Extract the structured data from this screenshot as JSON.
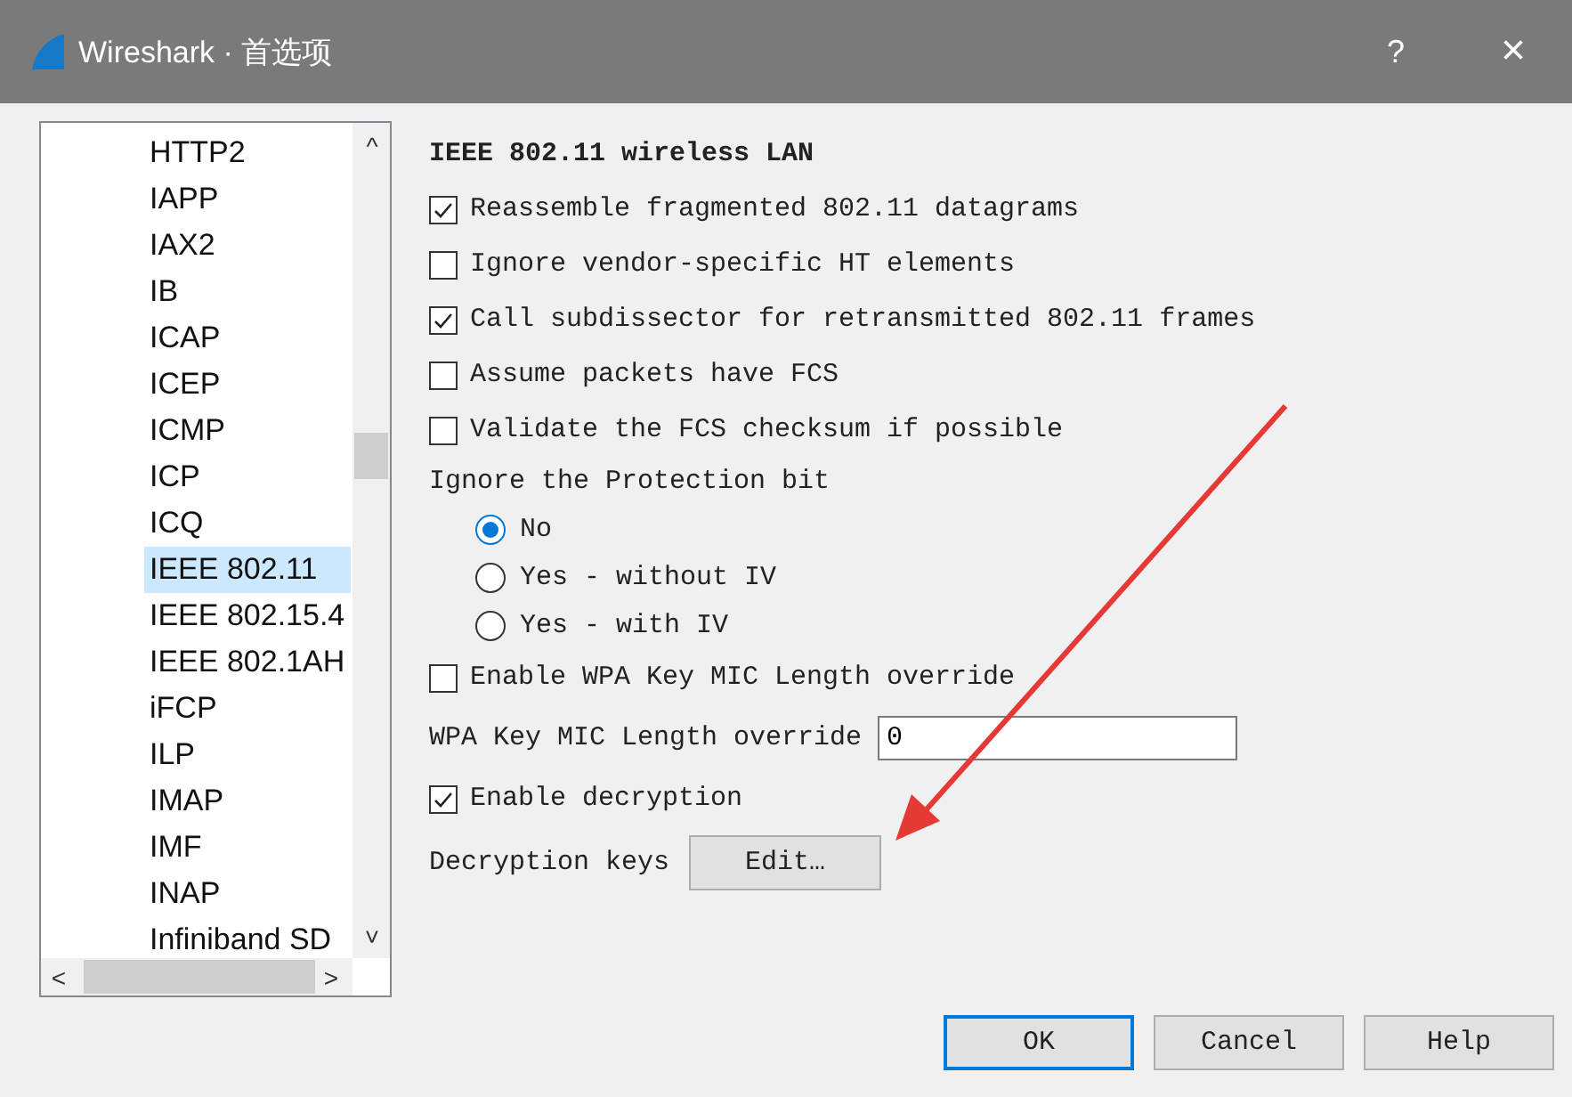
{
  "window": {
    "title": "Wireshark · 首选项",
    "help": "?",
    "close": "×"
  },
  "protocol_list": {
    "scroll_up": "^",
    "scroll_down": "˅",
    "scroll_left": "<",
    "scroll_right": ">",
    "items": [
      {
        "label": "HTTP2",
        "selected": false
      },
      {
        "label": "IAPP",
        "selected": false
      },
      {
        "label": "IAX2",
        "selected": false
      },
      {
        "label": "IB",
        "selected": false
      },
      {
        "label": "ICAP",
        "selected": false
      },
      {
        "label": "ICEP",
        "selected": false
      },
      {
        "label": "ICMP",
        "selected": false
      },
      {
        "label": "ICP",
        "selected": false
      },
      {
        "label": "ICQ",
        "selected": false
      },
      {
        "label": "IEEE 802.11",
        "selected": true
      },
      {
        "label": "IEEE 802.15.4",
        "selected": false
      },
      {
        "label": "IEEE 802.1AH",
        "selected": false
      },
      {
        "label": "iFCP",
        "selected": false
      },
      {
        "label": "ILP",
        "selected": false
      },
      {
        "label": "IMAP",
        "selected": false
      },
      {
        "label": "IMF",
        "selected": false
      },
      {
        "label": "INAP",
        "selected": false
      },
      {
        "label": "Infiniband SD",
        "selected": false
      }
    ]
  },
  "section_title": "IEEE 802.11 wireless LAN",
  "options": [
    {
      "kind": "checkbox",
      "label": "Reassemble fragmented 802.11 datagrams",
      "checked": true
    },
    {
      "kind": "checkbox",
      "label": "Ignore vendor-specific HT elements",
      "checked": false
    },
    {
      "kind": "checkbox",
      "label": "Call subdissector for retransmitted 802.11 frames",
      "checked": true
    },
    {
      "kind": "checkbox",
      "label": "Assume packets have FCS",
      "checked": false
    },
    {
      "kind": "checkbox",
      "label": "Validate the FCS checksum if possible",
      "checked": false
    },
    {
      "kind": "heading",
      "label": "Ignore the Protection bit"
    },
    {
      "kind": "radio",
      "label": "No",
      "selected": true
    },
    {
      "kind": "radio",
      "label": "Yes - without IV",
      "selected": false
    },
    {
      "kind": "radio",
      "label": "Yes - with IV",
      "selected": false
    },
    {
      "kind": "checkbox",
      "label": "Enable WPA Key MIC Length override",
      "checked": false
    },
    {
      "kind": "field",
      "label": "WPA Key MIC Length override",
      "value": "0"
    },
    {
      "kind": "checkbox",
      "label": "Enable decryption",
      "checked": true
    },
    {
      "kind": "button",
      "label": "Decryption keys",
      "button": "Edit…"
    }
  ],
  "buttons": [
    {
      "label": "OK",
      "default": true
    },
    {
      "label": "Cancel",
      "default": false
    },
    {
      "label": "Help",
      "default": false
    }
  ]
}
